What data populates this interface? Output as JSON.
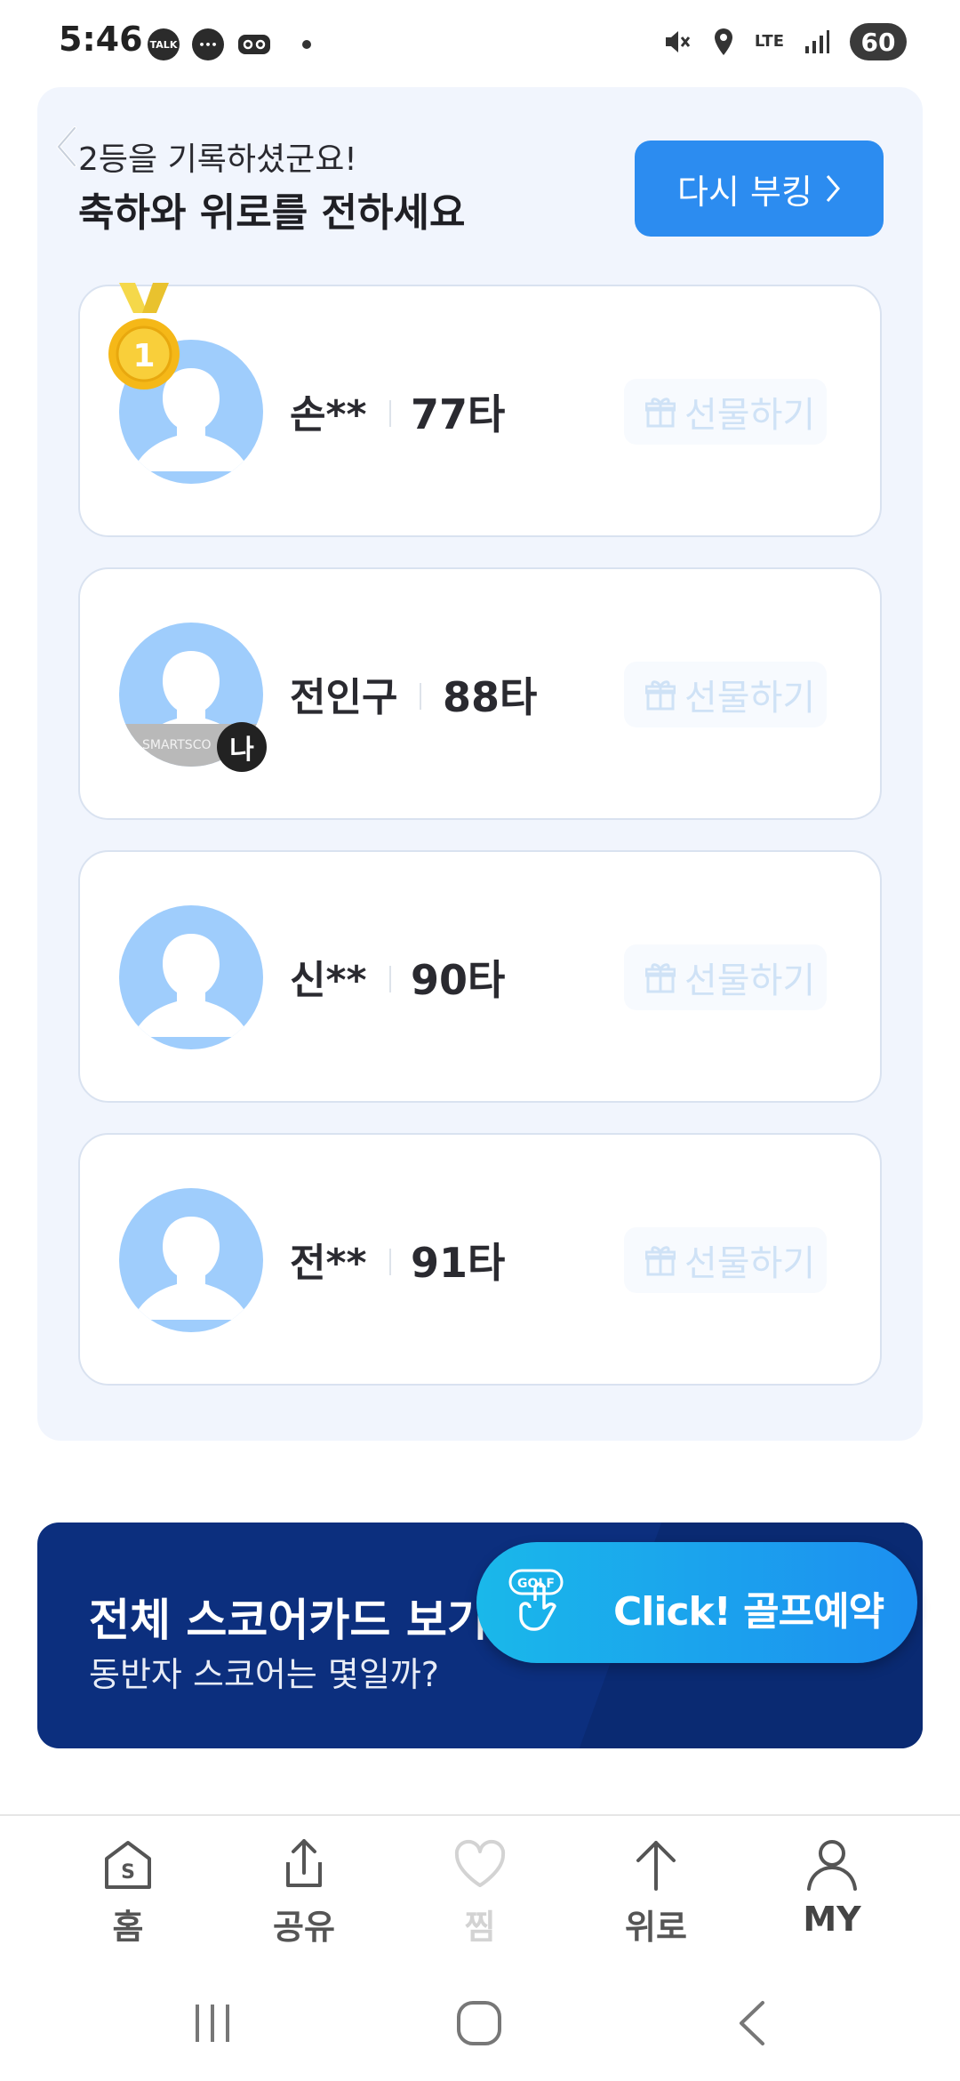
{
  "status_bar": {
    "time": "5:46",
    "left_icons": [
      "talk-icon",
      "message-icon",
      "voicemail-icon",
      "dot-icon"
    ],
    "right_icons": [
      "mute-icon",
      "location-icon",
      "lte-icon",
      "signal-icon"
    ],
    "network": "LTE",
    "battery": "60"
  },
  "result_panel": {
    "message_line1": "2등을 기록하셨군요!",
    "message_line2": "축하와 위로를 전하세요",
    "rebook_button": "다시 부킹",
    "players": [
      {
        "name": "손**",
        "score": "77타",
        "gift_label": "선물하기",
        "rank_medal": "1",
        "is_me": false
      },
      {
        "name": "전인구",
        "score": "88타",
        "gift_label": "선물하기",
        "is_me": true,
        "me_badge": "나",
        "avatar_band_text": "SMARTSCO"
      },
      {
        "name": "신**",
        "score": "90타",
        "gift_label": "선물하기",
        "is_me": false
      },
      {
        "name": "전**",
        "score": "91타",
        "gift_label": "선물하기",
        "is_me": false
      }
    ]
  },
  "banner": {
    "title": "전체 스코어카드 보기",
    "subtitle": "동반자 스코어는 몇일까?"
  },
  "golf_button": {
    "icon_text": "GOLF",
    "label": "Click! 골프예약"
  },
  "bottom_nav": {
    "items": [
      {
        "label": "홈",
        "icon": "home-icon"
      },
      {
        "label": "공유",
        "icon": "share-icon"
      },
      {
        "label": "찜",
        "icon": "heart-icon"
      },
      {
        "label": "위로",
        "icon": "arrow-up-icon"
      },
      {
        "label": "MY",
        "icon": "person-icon"
      }
    ]
  },
  "colors": {
    "accent": "#2c8cf0",
    "panel_bg": "#f1f5fd",
    "banner_bg": "#0c2f7e",
    "avatar": "#9fcdfc"
  }
}
